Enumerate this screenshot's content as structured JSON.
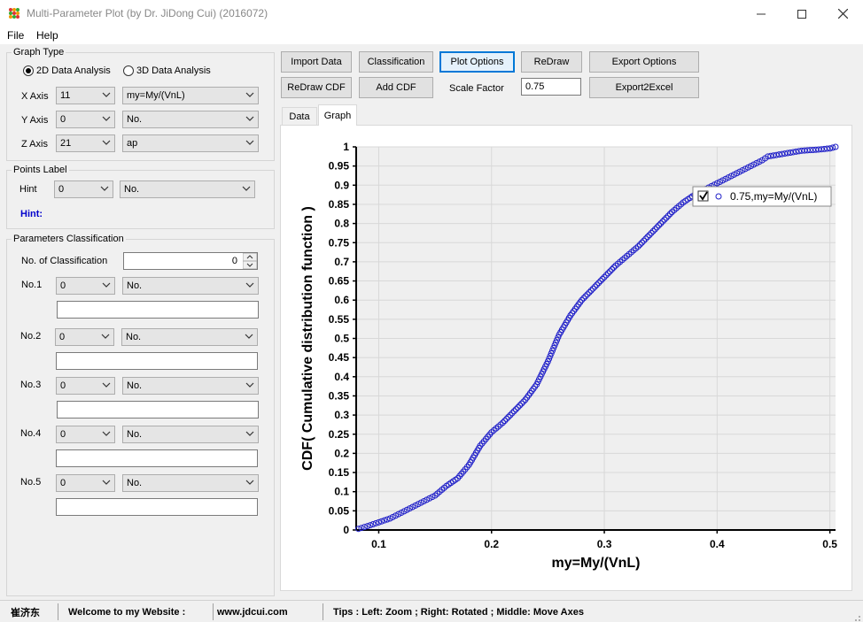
{
  "window": {
    "title": "Multi-Parameter Plot (by Dr. JiDong Cui) (2016072)"
  },
  "menu": [
    "File",
    "Help"
  ],
  "graph_type": {
    "title": "Graph Type",
    "option_2d": "2D Data Analysis",
    "option_3d": "3D Data Analysis",
    "selected": "2D Data Analysis",
    "x_axis": {
      "label": "X Axis",
      "index": "11",
      "param": "my=My/(VnL)"
    },
    "y_axis": {
      "label": "Y Axis",
      "index": "0",
      "param": "No."
    },
    "z_axis": {
      "label": "Z Axis",
      "index": "21",
      "param": "ap"
    }
  },
  "points_label": {
    "title": "Points Label",
    "hint_label": "Hint",
    "hint_index": "0",
    "hint_param": "No.",
    "hint_text": "Hint:"
  },
  "classification": {
    "title": "Parameters Classification",
    "count_label": "No. of Classification",
    "count_value": "0",
    "rows": [
      {
        "label": "No.1",
        "index": "0",
        "param": "No.",
        "value": ""
      },
      {
        "label": "No.2",
        "index": "0",
        "param": "No.",
        "value": ""
      },
      {
        "label": "No.3",
        "index": "0",
        "param": "No.",
        "value": ""
      },
      {
        "label": "No.4",
        "index": "0",
        "param": "No.",
        "value": ""
      },
      {
        "label": "No.5",
        "index": "0",
        "param": "No.",
        "value": ""
      }
    ]
  },
  "toolbar": {
    "import_data": "Import Data",
    "classification": "Classification",
    "plot_options": "Plot Options",
    "redraw": "ReDraw",
    "export_options": "Export Options",
    "redraw_cdf": "ReDraw CDF",
    "add_cdf": "Add CDF",
    "scale_factor_label": "Scale Factor",
    "scale_factor_value": "0.75",
    "export2excel": "Export2Excel"
  },
  "tabs": {
    "data": "Data",
    "graph": "Graph",
    "active": "Graph"
  },
  "status": {
    "name": "崔济东",
    "welcome": "Welcome to my Website :",
    "website": "www.jdcui.com",
    "tips": "Tips : Left: Zoom ; Right: Rotated ; Middle: Move Axes"
  },
  "colors": {
    "accent": "#0078d7",
    "series": "#1f1fc8",
    "hint": "#0000cc"
  },
  "chart_data": {
    "type": "scatter",
    "xlabel": "my=My/(VnL)",
    "ylabel": "CDF( Cumulative distribution function )",
    "xlim": [
      0.08,
      0.505
    ],
    "ylim": [
      0,
      1
    ],
    "xticks": [
      "0.1",
      "0.2",
      "0.3",
      "0.4",
      "0.5"
    ],
    "yticks": [
      "0",
      "0.05",
      "0.1",
      "0.15",
      "0.2",
      "0.25",
      "0.3",
      "0.35",
      "0.4",
      "0.45",
      "0.5",
      "0.55",
      "0.6",
      "0.65",
      "0.7",
      "0.75",
      "0.8",
      "0.85",
      "0.9",
      "0.95",
      "1"
    ],
    "grid": true,
    "legend_position": "top-right",
    "series": [
      {
        "name": "0.75,my=My/(VnL)",
        "marker": "open-circle",
        "points": [
          {
            "x": 0.082,
            "y": 0.003
          },
          {
            "x": 0.09,
            "y": 0.01
          },
          {
            "x": 0.1,
            "y": 0.02
          },
          {
            "x": 0.11,
            "y": 0.03
          },
          {
            "x": 0.12,
            "y": 0.045
          },
          {
            "x": 0.13,
            "y": 0.06
          },
          {
            "x": 0.14,
            "y": 0.075
          },
          {
            "x": 0.15,
            "y": 0.09
          },
          {
            "x": 0.16,
            "y": 0.115
          },
          {
            "x": 0.17,
            "y": 0.135
          },
          {
            "x": 0.18,
            "y": 0.17
          },
          {
            "x": 0.19,
            "y": 0.22
          },
          {
            "x": 0.2,
            "y": 0.255
          },
          {
            "x": 0.21,
            "y": 0.28
          },
          {
            "x": 0.22,
            "y": 0.31
          },
          {
            "x": 0.23,
            "y": 0.34
          },
          {
            "x": 0.24,
            "y": 0.38
          },
          {
            "x": 0.25,
            "y": 0.44
          },
          {
            "x": 0.26,
            "y": 0.51
          },
          {
            "x": 0.27,
            "y": 0.56
          },
          {
            "x": 0.28,
            "y": 0.6
          },
          {
            "x": 0.29,
            "y": 0.63
          },
          {
            "x": 0.3,
            "y": 0.66
          },
          {
            "x": 0.31,
            "y": 0.69
          },
          {
            "x": 0.32,
            "y": 0.715
          },
          {
            "x": 0.33,
            "y": 0.74
          },
          {
            "x": 0.34,
            "y": 0.77
          },
          {
            "x": 0.35,
            "y": 0.8
          },
          {
            "x": 0.36,
            "y": 0.83
          },
          {
            "x": 0.37,
            "y": 0.855
          },
          {
            "x": 0.38,
            "y": 0.875
          },
          {
            "x": 0.39,
            "y": 0.89
          },
          {
            "x": 0.4,
            "y": 0.905
          },
          {
            "x": 0.41,
            "y": 0.92
          },
          {
            "x": 0.42,
            "y": 0.935
          },
          {
            "x": 0.43,
            "y": 0.95
          },
          {
            "x": 0.44,
            "y": 0.965
          },
          {
            "x": 0.445,
            "y": 0.975
          },
          {
            "x": 0.455,
            "y": 0.98
          },
          {
            "x": 0.475,
            "y": 0.99
          },
          {
            "x": 0.49,
            "y": 0.993
          },
          {
            "x": 0.5,
            "y": 0.996
          },
          {
            "x": 0.505,
            "y": 1.0
          }
        ]
      }
    ]
  }
}
